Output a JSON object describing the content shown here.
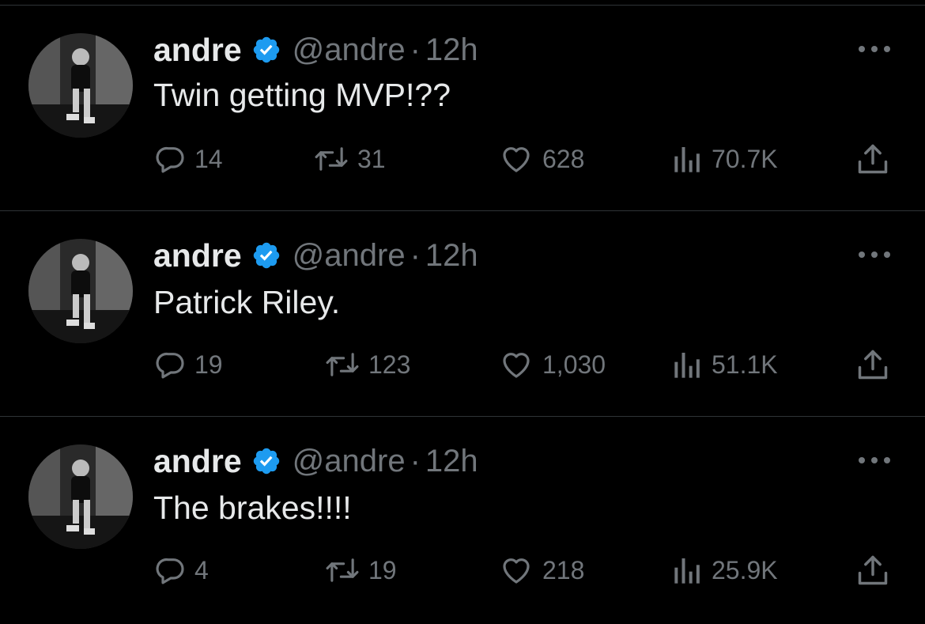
{
  "tweets": [
    {
      "author": {
        "name": "andre",
        "handle": "@andre",
        "verified": true,
        "avatar": "avatar-photo-icon"
      },
      "separator": "·",
      "time": "12h",
      "text": "Twin getting MVP!??",
      "stats": {
        "replies": "14",
        "retweets": "31",
        "likes": "628",
        "views": "70.7K"
      }
    },
    {
      "author": {
        "name": "andre",
        "handle": "@andre",
        "verified": true,
        "avatar": "avatar-photo-icon"
      },
      "separator": "·",
      "time": "12h",
      "text": "Patrick Riley.",
      "stats": {
        "replies": "19",
        "retweets": "123",
        "likes": "1,030",
        "views": "51.1K"
      }
    },
    {
      "author": {
        "name": "andre",
        "handle": "@andre",
        "verified": true,
        "avatar": "avatar-photo-icon"
      },
      "separator": "·",
      "time": "12h",
      "text": "The brakes!!!!",
      "stats": {
        "replies": "4",
        "retweets": "19",
        "likes": "218",
        "views": "25.9K"
      }
    }
  ],
  "colors": {
    "background": "#000000",
    "text": "#e7e9ea",
    "muted": "#71767b",
    "verified": "#1d9bf0",
    "divider": "#2f3336"
  },
  "icons": [
    "reply-icon",
    "retweet-icon",
    "like-icon",
    "views-icon",
    "share-icon",
    "more-icon",
    "verified-badge-icon"
  ]
}
